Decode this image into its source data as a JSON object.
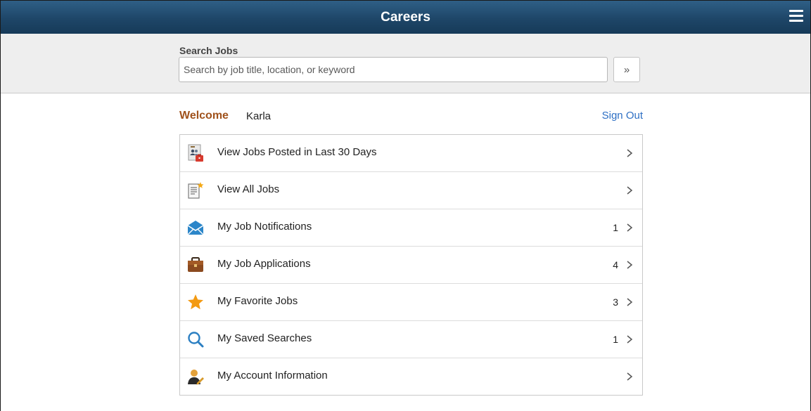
{
  "header": {
    "title": "Careers",
    "menu_icon": "hamburger-menu-icon",
    "background": "#1e4668"
  },
  "search": {
    "label": "Search Jobs",
    "placeholder": "Search by job title, location, or keyword",
    "value": "",
    "button_label": "»"
  },
  "welcome": {
    "greeting": "Welcome",
    "name": "Karla",
    "sign_out": "Sign Out",
    "greeting_color": "#a0521c",
    "link_color": "#2d6fc4"
  },
  "menu": {
    "items": [
      {
        "label": "View Jobs Posted in Last 30 Days",
        "count": "",
        "icon": "recent-jobs-icon"
      },
      {
        "label": "View All Jobs",
        "count": "",
        "icon": "all-jobs-document-icon"
      },
      {
        "label": "My Job Notifications",
        "count": "1",
        "icon": "envelope-icon"
      },
      {
        "label": "My Job Applications",
        "count": "4",
        "icon": "briefcase-icon"
      },
      {
        "label": "My Favorite Jobs",
        "count": "3",
        "icon": "star-icon"
      },
      {
        "label": "My Saved Searches",
        "count": "1",
        "icon": "magnifier-icon"
      },
      {
        "label": "My Account Information",
        "count": "",
        "icon": "account-user-icon"
      }
    ]
  }
}
